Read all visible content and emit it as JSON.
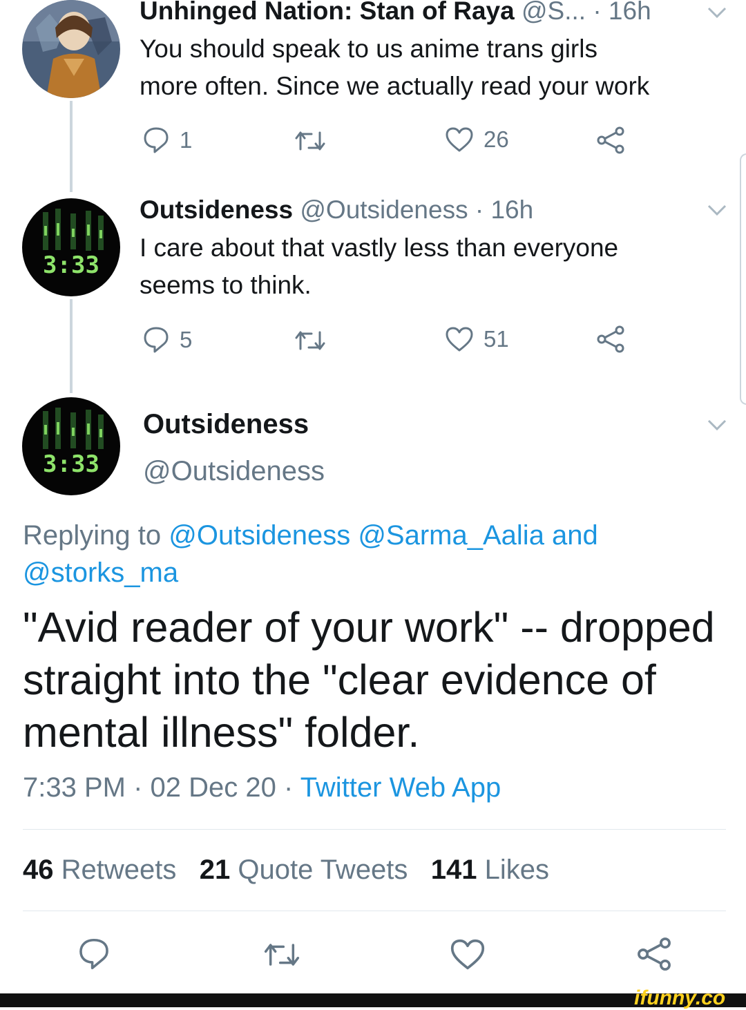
{
  "tweet1": {
    "name": "Unhinged Nation: Stan of Raya",
    "handle": "@S...",
    "time": "· 16h",
    "text_line1": "You should speak to us anime trans girls",
    "text_line2": "more often. Since we actually read your work",
    "replies": "1",
    "likes": "26"
  },
  "tweet2": {
    "name": "Outsideness",
    "handle": "@Outsideness",
    "time": "· 16h",
    "text_line1": "I care about that vastly less than everyone",
    "text_line2": "seems to think.",
    "replies": "5",
    "likes": "51",
    "avatar_text": "3:33"
  },
  "main": {
    "name": "Outsideness",
    "handle": "@Outsideness",
    "avatar_text": "3:33",
    "replying_prefix": "Replying to",
    "reply_user1": "@Outsideness",
    "reply_user2": "@Sarma_Aalia and",
    "reply_user3": "@storks_ma",
    "text_line1": "\"Avid reader of your work\" -- dropped",
    "text_line2": "straight into the \"clear evidence of",
    "text_line3": "mental illness\" folder.",
    "timestamp": "7:33 PM · 02 Dec 20 ·",
    "source": "Twitter Web App",
    "retweets_count": "46",
    "retweets_label": "Retweets",
    "quotes_count": "21",
    "quotes_label": "Quote Tweets",
    "likes_count": "141",
    "likes_label": "Likes"
  },
  "watermark": "ifunny.co",
  "colors": {
    "link": "#1b95e0",
    "meta": "#657786",
    "text": "#14171a",
    "divider": "#e1e8ed",
    "watermark": "#ffd21f"
  },
  "icons": [
    "reply-icon",
    "retweet-icon",
    "like-icon",
    "share-icon",
    "chevron-down-icon"
  ]
}
